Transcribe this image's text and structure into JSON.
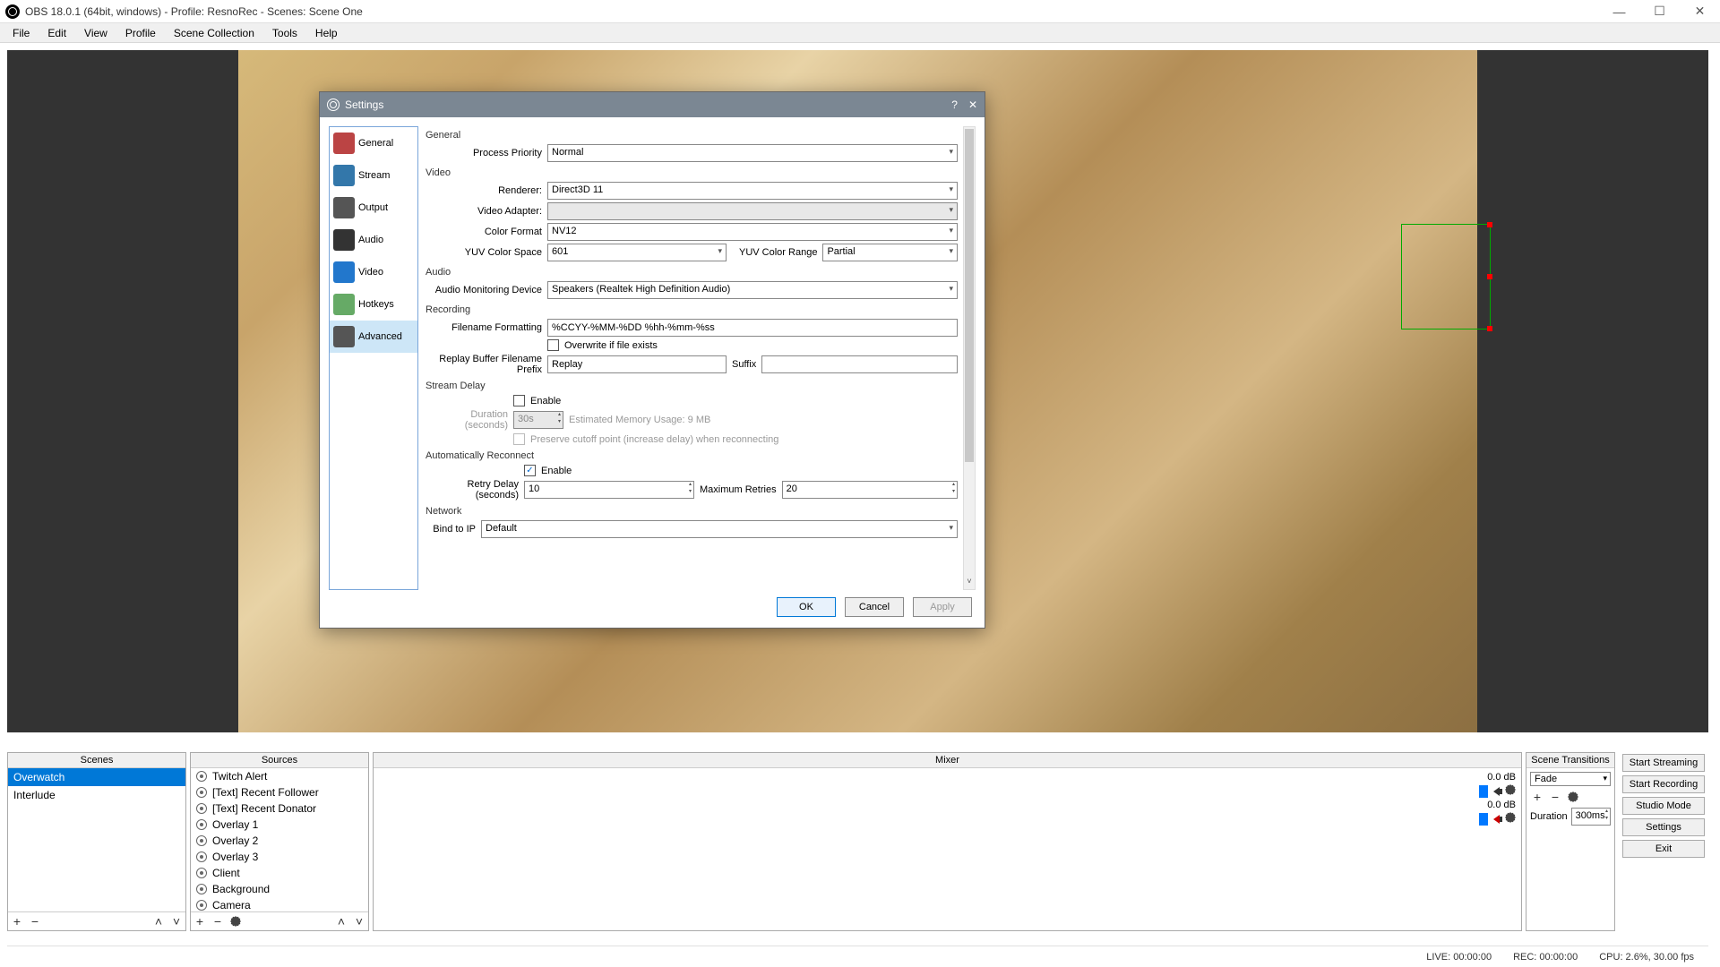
{
  "window": {
    "title": "OBS 18.0.1 (64bit, windows) - Profile: ResnoRec - Scenes: Scene One"
  },
  "menubar": [
    "File",
    "Edit",
    "View",
    "Profile",
    "Scene Collection",
    "Tools",
    "Help"
  ],
  "scenes": {
    "title": "Scenes",
    "items": [
      "Overwatch",
      "Interlude"
    ],
    "selected_index": 0
  },
  "sources": {
    "title": "Sources",
    "items": [
      "Twitch Alert",
      "[Text] Recent Follower",
      "[Text] Recent Donator",
      "Overlay 1",
      "Overlay 2",
      "Overlay 3",
      "Client",
      "Background",
      "Camera"
    ]
  },
  "mixer": {
    "title": "Mixer",
    "db1": "0.0 dB",
    "db2": "0.0 dB"
  },
  "transitions": {
    "title": "Scene Transitions",
    "current": "Fade",
    "duration_label": "Duration",
    "duration_value": "300ms"
  },
  "controls": {
    "start_streaming": "Start Streaming",
    "start_recording": "Start Recording",
    "studio_mode": "Studio Mode",
    "settings": "Settings",
    "exit": "Exit"
  },
  "statusbar": {
    "live": "LIVE: 00:00:00",
    "rec": "REC: 00:00:00",
    "cpu": "CPU: 2.6%, 30.00 fps"
  },
  "settings": {
    "title": "Settings",
    "categories": [
      "General",
      "Stream",
      "Output",
      "Audio",
      "Video",
      "Hotkeys",
      "Advanced"
    ],
    "selected_category": 6,
    "general": {
      "heading": "General",
      "process_priority_label": "Process Priority",
      "process_priority_value": "Normal"
    },
    "video": {
      "heading": "Video",
      "renderer_label": "Renderer:",
      "renderer_value": "Direct3D 11",
      "video_adapter_label": "Video Adapter:",
      "video_adapter_value": "",
      "color_format_label": "Color Format",
      "color_format_value": "NV12",
      "yuv_color_space_label": "YUV Color Space",
      "yuv_color_space_value": "601",
      "yuv_color_range_label": "YUV Color Range",
      "yuv_color_range_value": "Partial"
    },
    "audio": {
      "heading": "Audio",
      "monitoring_label": "Audio Monitoring Device",
      "monitoring_value": "Speakers (Realtek High Definition Audio)"
    },
    "recording": {
      "heading": "Recording",
      "filename_formatting_label": "Filename Formatting",
      "filename_formatting_value": "%CCYY-%MM-%DD %hh-%mm-%ss",
      "overwrite_label": "Overwrite if file exists",
      "overwrite_checked": false,
      "prefix_label": "Replay Buffer Filename Prefix",
      "prefix_value": "Replay",
      "suffix_label": "Suffix",
      "suffix_value": ""
    },
    "stream_delay": {
      "heading": "Stream Delay",
      "enable_label": "Enable",
      "enable_checked": false,
      "duration_label": "Duration (seconds)",
      "duration_value": "30s",
      "estimate_label": "Estimated Memory Usage: 9 MB",
      "preserve_label": "Preserve cutoff point (increase delay) when reconnecting"
    },
    "auto_reconnect": {
      "heading": "Automatically Reconnect",
      "enable_label": "Enable",
      "enable_checked": true,
      "retry_delay_label": "Retry Delay (seconds)",
      "retry_delay_value": "10",
      "max_retries_label": "Maximum Retries",
      "max_retries_value": "20"
    },
    "network": {
      "heading": "Network",
      "bind_label": "Bind to IP",
      "bind_value": "Default"
    },
    "buttons": {
      "ok": "OK",
      "cancel": "Cancel",
      "apply": "Apply"
    }
  }
}
